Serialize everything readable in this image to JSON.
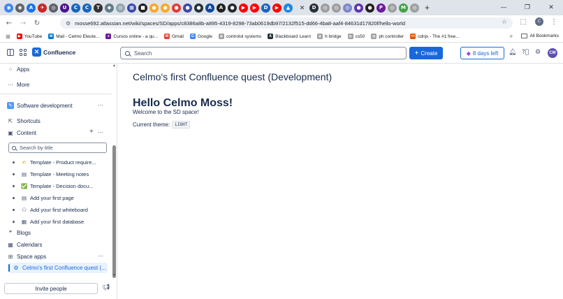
{
  "browser": {
    "tabs": [
      {
        "icon": "chrome-icon",
        "color": "#4285f4",
        "glyph": "◉"
      },
      {
        "icon": "chrome-icon",
        "color": "#5f6368",
        "glyph": "◉"
      },
      {
        "icon": "a-icon",
        "color": "#1a73e8",
        "glyph": "A"
      },
      {
        "icon": "bird-icon",
        "color": "#c62828",
        "glyph": "✈"
      },
      {
        "icon": "globe-icon",
        "color": "#5f6368",
        "glyph": "◎"
      },
      {
        "icon": "u-icon",
        "color": "#4a148c",
        "glyph": "U"
      },
      {
        "icon": "c-icon",
        "color": "#1565c0",
        "glyph": "C"
      },
      {
        "icon": "c-icon",
        "color": "#1565c0",
        "glyph": "C"
      },
      {
        "icon": "t-icon",
        "color": "#333333",
        "glyph": "T"
      },
      {
        "icon": "shield-icon",
        "color": "#607d8b",
        "glyph": "◆"
      },
      {
        "icon": "globe-icon",
        "color": "#90a4ae",
        "glyph": "◎"
      },
      {
        "icon": "grid-icon",
        "color": "#3949ab",
        "glyph": "▦"
      },
      {
        "icon": "black-icon",
        "color": "#212121",
        "glyph": "■"
      },
      {
        "icon": "yellow-icon",
        "color": "#f9a825",
        "glyph": "●"
      },
      {
        "icon": "yellow-icon",
        "color": "#f9a825",
        "glyph": "●"
      },
      {
        "icon": "red-icon",
        "color": "#e53935",
        "glyph": "●"
      },
      {
        "icon": "blue-icon",
        "color": "#3949ab",
        "glyph": "●"
      },
      {
        "icon": "dark-icon",
        "color": "#263238",
        "glyph": "●"
      },
      {
        "icon": "a-icon",
        "color": "#0d47a1",
        "glyph": "A"
      },
      {
        "icon": "a-icon",
        "color": "#212121",
        "glyph": "A"
      },
      {
        "icon": "github-icon",
        "color": "#24292e",
        "glyph": "●"
      },
      {
        "icon": "youtube-icon",
        "color": "#ff0000",
        "glyph": "▶"
      },
      {
        "icon": "youtube-icon",
        "color": "#ff0000",
        "glyph": "▶"
      },
      {
        "icon": "d-icon",
        "color": "#1565c0",
        "glyph": "D"
      },
      {
        "icon": "youtube-icon",
        "color": "#ff0000",
        "glyph": "▶"
      },
      {
        "icon": "triangle-icon",
        "color": "#1e88e5",
        "glyph": "▲"
      }
    ],
    "tabs_right": [
      {
        "icon": "d-icon",
        "color": "#263238",
        "glyph": "D"
      },
      {
        "icon": "globe-icon",
        "color": "#9e9e9e",
        "glyph": "◎"
      },
      {
        "icon": "globe-icon",
        "color": "#9e9e9e",
        "glyph": "◎"
      },
      {
        "icon": "globe-icon",
        "color": "#7986cb",
        "glyph": "◎"
      },
      {
        "icon": "p-icon",
        "color": "#5e35b1",
        "glyph": "●"
      },
      {
        "icon": "black-icon",
        "color": "#212121",
        "glyph": "●"
      },
      {
        "icon": "p-icon",
        "color": "#6a1b9a",
        "glyph": "P"
      },
      {
        "icon": "globe-icon",
        "color": "#9e9e9e",
        "glyph": "◎"
      },
      {
        "icon": "gmail-icon",
        "color": "#43a047",
        "glyph": "M"
      },
      {
        "icon": "globe-icon",
        "color": "#9e9e9e",
        "glyph": "◎"
      }
    ],
    "url": "mosse692.atlassian.net/wiki/spaces/SD/apps/c8386a8b-a895-4319-8298-73ab0619db97/2132f515-dd66-4ba8-aaf4-84631d17820f/hello-world",
    "profile_initial": "C",
    "bookmarks": [
      {
        "label": "YouTube",
        "color": "#ff0000",
        "glyph": "▶"
      },
      {
        "label": "Mail - Celmo Eleute...",
        "color": "#0078d4",
        "glyph": "✉"
      },
      {
        "label": "Cursos online - a qu...",
        "color": "#6a1b9a",
        "glyph": "●"
      },
      {
        "label": "Gmail",
        "color": "#ea4335",
        "glyph": "M"
      },
      {
        "label": "Google",
        "color": "#4285f4",
        "glyph": "G"
      },
      {
        "label": "controlol systems",
        "color": "#9e9e9e",
        "glyph": "◎"
      },
      {
        "label": "Blackboard Learn",
        "color": "#263238",
        "glyph": "A"
      },
      {
        "label": "h bridge",
        "color": "#9e9e9e",
        "glyph": "◎"
      },
      {
        "label": "cs50",
        "color": "#9e9e9e",
        "glyph": "◎"
      },
      {
        "label": "ph controller",
        "color": "#9e9e9e",
        "glyph": "◎"
      },
      {
        "label": "cdnjs - The #1 free...",
        "color": "#e65100",
        "glyph": "<>"
      }
    ],
    "bookmarks_more": "»",
    "all_bookmarks": "All Bookmarks"
  },
  "topnav": {
    "product": "Confluence",
    "search_placeholder": "Search",
    "create_label": "Create",
    "trial_label": "8 days left",
    "avatar_initials": "CM"
  },
  "sidebar": {
    "apps": "Apps",
    "more": "More",
    "space_name": "Software development",
    "shortcuts": "Shortcuts",
    "content": "Content",
    "search_placeholder": "Search by title",
    "tree": [
      {
        "label": "Template - Product require...",
        "icon": "pencil-icon",
        "glyph": "✍"
      },
      {
        "label": "Template - Meeting notes",
        "icon": "page-icon",
        "glyph": "▤"
      },
      {
        "label": "Template - Decision docu...",
        "icon": "check-icon",
        "glyph": "✅"
      },
      {
        "label": "Add your first page",
        "icon": "page-icon",
        "glyph": "▤"
      },
      {
        "label": "Add your first whiteboard",
        "icon": "whiteboard-icon",
        "glyph": "⚇"
      },
      {
        "label": "Add your first database",
        "icon": "database-icon",
        "glyph": "▦"
      }
    ],
    "blogs": "Blogs",
    "calendars": "Calendars",
    "space_apps": "Space apps",
    "active_app": "Celmo's first Confluence quest (...",
    "invite": "Invite people"
  },
  "main": {
    "title": "Celmo's first Confluence quest (Development)",
    "heading": "Hello Celmo Moss!",
    "welcome": "Welcome to the SD space!",
    "theme_label": "Current theme:",
    "theme_value": "LIGHT"
  }
}
